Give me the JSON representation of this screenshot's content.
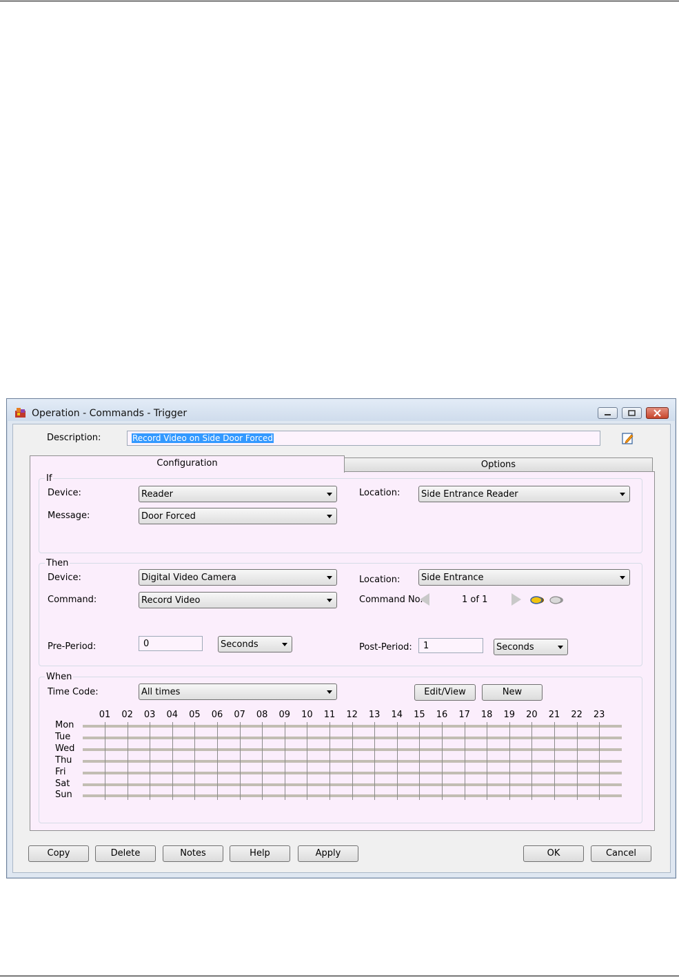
{
  "window": {
    "title": "Operation - Commands - Trigger"
  },
  "description": {
    "label": "Description:",
    "value": "Record Video on Side Door Forced"
  },
  "tabs": [
    {
      "label": "Configuration",
      "active": true
    },
    {
      "label": "Options",
      "active": false
    }
  ],
  "if_group": {
    "title": "If",
    "device_label": "Device:",
    "device_value": "Reader",
    "message_label": "Message:",
    "message_value": "Door Forced",
    "location_label": "Location:",
    "location_value": "Side Entrance Reader"
  },
  "then_group": {
    "title": "Then",
    "device_label": "Device:",
    "device_value": "Digital Video Camera",
    "command_label": "Command:",
    "command_value": "Record Video",
    "location_label": "Location:",
    "location_value": "Side Entrance",
    "command_no_label": "Command No.",
    "command_no_value": "1 of 1",
    "pre_period_label": "Pre-Period:",
    "pre_period_value": "0",
    "pre_period_unit": "Seconds",
    "post_period_label": "Post-Period:",
    "post_period_value": "1",
    "post_period_unit": "Seconds"
  },
  "when_group": {
    "title": "When",
    "time_code_label": "Time Code:",
    "time_code_value": "All times",
    "edit_view_button": "Edit/View",
    "new_button": "New",
    "hours": [
      "01",
      "02",
      "03",
      "04",
      "05",
      "06",
      "07",
      "08",
      "09",
      "10",
      "11",
      "12",
      "13",
      "14",
      "15",
      "16",
      "17",
      "18",
      "19",
      "20",
      "21",
      "22",
      "23"
    ],
    "days": [
      "Mon",
      "Tue",
      "Wed",
      "Thu",
      "Fri",
      "Sat",
      "Sun"
    ]
  },
  "footer": {
    "copy": "Copy",
    "delete": "Delete",
    "notes": "Notes",
    "help": "Help",
    "apply": "Apply",
    "ok": "OK",
    "cancel": "Cancel"
  },
  "colors": {
    "field_bg": "#fdf3fd",
    "selection": "#3399ff",
    "schedule_bar": "#c2bdb3"
  }
}
